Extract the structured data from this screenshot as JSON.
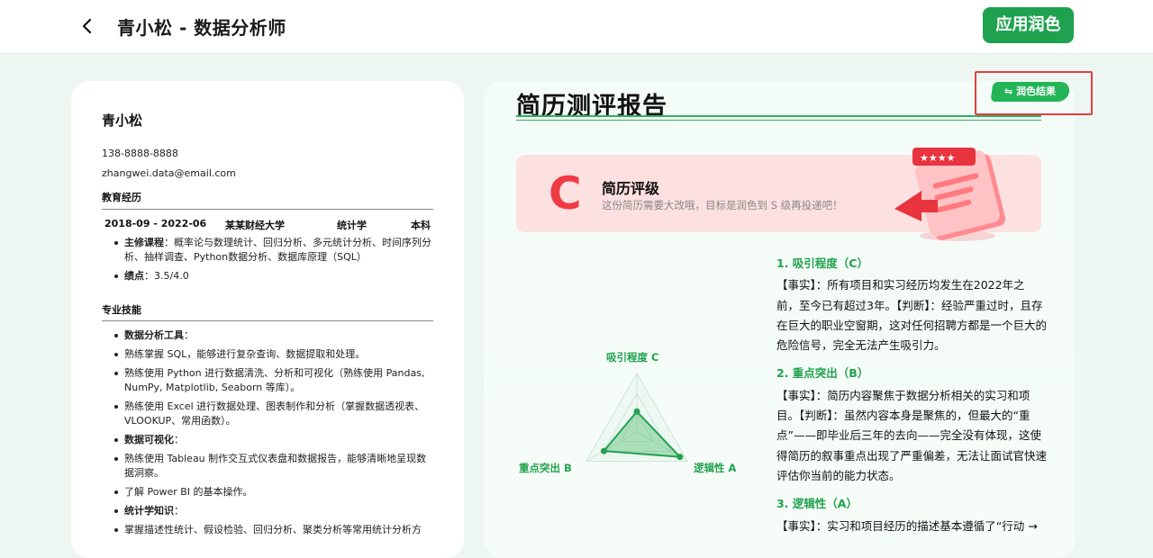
{
  "header": {
    "title": "青小松 - 数据分析师",
    "apply_label": "应用润色"
  },
  "resume": {
    "name": "青小松",
    "phone": "138-8888-8888",
    "email": "zhangwei.data@email.com",
    "education": {
      "heading": "教育经历",
      "period": "2018-09 - 2022-06",
      "school": "某某财经大学",
      "major": "统计学",
      "degree": "本科",
      "courses_label": "主修课程",
      "courses": "：概率论与数理统计、回归分析、多元统计分析、时间序列分析、抽样调查、Python数据分析、数据库原理（SQL）",
      "gpa_label": "绩点",
      "gpa": "：3.5/4.0"
    },
    "skills": {
      "heading": "专业技能",
      "tools_label": "数据分析工具",
      "tools_colon": "：",
      "sql": "熟练掌握 SQL，能够进行复杂查询、数据提取和处理。",
      "python": "熟练使用 Python 进行数据清洗、分析和可视化（熟练使用 Pandas, NumPy, Matplotlib, Seaborn 等库）。",
      "excel": "熟练使用 Excel 进行数据处理、图表制作和分析（掌握数据透视表、VLOOKUP、常用函数）。",
      "viz_label": "数据可视化",
      "viz_colon": "：",
      "tableau": "熟练使用 Tableau 制作交互式仪表盘和数据报告，能够清晰地呈现数据洞察。",
      "powerbi": "了解 Power BI 的基本操作。",
      "stats_label": "统计学知识",
      "stats_colon": "：",
      "stats": "掌握描述性统计、假设检验、回归分析、聚类分析等常用统计分析方"
    }
  },
  "report": {
    "title": "简历测评报告",
    "result_label": "润色结果",
    "grade": {
      "letter": "C",
      "title": "简历评级",
      "subtitle": "这份简历需要大改哦，目标是润色到 S 级再投递吧！"
    },
    "radar": {
      "labels": {
        "top": "吸引程度 C",
        "left": "重点突出 B",
        "right": "逻辑性 A"
      },
      "levels": {
        "attraction": 0.35,
        "focus": 0.65,
        "logic": 0.85
      }
    },
    "items": [
      {
        "heading": "1. 吸引程度（C）",
        "text": "【事实】：所有项目和实习经历均发生在2022年之前，至今已有超过3年。【判断】：经验严重过时，且存在巨大的职业空窗期，这对任何招聘方都是一个巨大的危险信号，完全无法产生吸引力。"
      },
      {
        "heading": "2. 重点突出（B）",
        "text": "【事实】：简历内容聚焦于数据分析相关的实习和项目。【判断】：虽然内容本身是聚焦的，但最大的“重点”——即毕业后三年的去向——完全没有体现，这使得简历的叙事重点出现了严重偏差，无法让面试官快速评估你当前的能力状态。"
      },
      {
        "heading": "3. 逻辑性（A）",
        "text": "【事实】：实习和项目经历的描述基本遵循了“行动 →"
      }
    ]
  },
  "colors": {
    "accent": "#1fa24f",
    "grade": "#f03a46"
  }
}
